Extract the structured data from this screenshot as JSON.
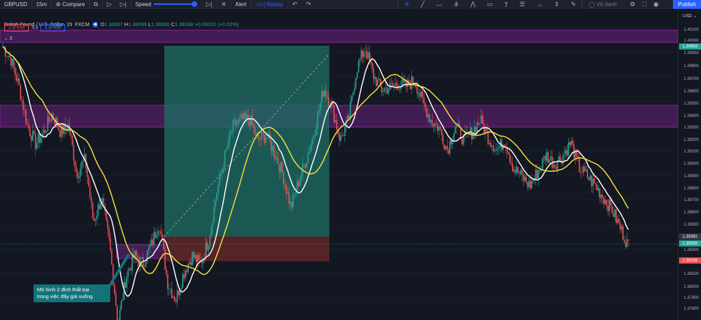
{
  "toolbar": {
    "symbol": "GBPUSD",
    "interval": "15m",
    "compare_label": "Compare",
    "speed_label": "Speed",
    "alert_label": "Alert",
    "replay_label": "Replay",
    "user_label": "Vô danh",
    "publish_label": "Publish"
  },
  "legend": {
    "title": "British Pound / U.S. Dollar",
    "interval": "15",
    "source": "FXCM",
    "o_label": "O",
    "o": "1.38307",
    "h_label": "H",
    "h": "1.38399",
    "l_label": "L",
    "l": "1.38306",
    "c_label": "C",
    "c": "1.38338",
    "change": "+0.00031 (+0.02%)"
  },
  "quote": {
    "sell": "1.37439",
    "spread": "0.3",
    "buy": "1.37439"
  },
  "indicators_toggle": "3",
  "annotation": {
    "text_line1": "Mô hình 2 đỉnh thất bại",
    "text_line2": "trong việc đẩy giá xuống"
  },
  "price_axis": {
    "currency": "USD",
    "ticks": [
      "1.40100",
      "1.40000",
      "1.39900",
      "1.39800",
      "1.39700",
      "1.39600",
      "1.39500",
      "1.39400",
      "1.39300",
      "1.39200",
      "1.39100",
      "1.39000",
      "1.38900",
      "1.38800",
      "1.38700",
      "1.38600",
      "1.38500",
      "1.38300",
      "1.38100",
      "1.38000",
      "1.37900",
      "1.37800"
    ],
    "tag_high": "1.39959",
    "tag_pos": "1.38392",
    "tag_last": "1.38338",
    "tag_low": "1.38195"
  },
  "colors": {
    "bg": "#131722",
    "up": "#26a69a",
    "down": "#ef5350",
    "ma_white": "#ffffff",
    "ma_yellow": "#f7e23c",
    "zone": "#9c27b0",
    "long_profit": "#1f6f66",
    "long_loss": "#6b2a2a",
    "accent": "#2962ff"
  },
  "chart_data": {
    "type": "candlestick",
    "symbol": "GBPUSD",
    "timeframe": "15",
    "ylim": [
      1.377,
      1.4012
    ],
    "price_path": [
      1.3996,
      1.3985,
      1.3962,
      1.393,
      1.3915,
      1.3925,
      1.394,
      1.3925,
      1.393,
      1.389,
      1.3902,
      1.385,
      1.387,
      1.383,
      1.3765,
      1.3805,
      1.3822,
      1.3815,
      1.383,
      1.385,
      1.38,
      1.3785,
      1.3808,
      1.3822,
      1.3815,
      1.3835,
      1.3875,
      1.3905,
      1.393,
      1.3935,
      1.3935,
      1.3918,
      1.3922,
      1.3908,
      1.389,
      1.3862,
      1.3885,
      1.3905,
      1.393,
      1.3962,
      1.3945,
      1.3918,
      1.3935,
      1.3978,
      1.3995,
      1.3972,
      1.396,
      1.3962,
      1.3965,
      1.3963,
      1.3968,
      1.395,
      1.3935,
      1.3928,
      1.391,
      1.393,
      1.3918,
      1.3925,
      1.3935,
      1.392,
      1.391,
      1.3918,
      1.3895,
      1.3888,
      1.388,
      1.3892,
      1.3906,
      1.3898,
      1.3905,
      1.3916,
      1.3895,
      1.3888,
      1.388,
      1.387,
      1.386,
      1.3845,
      1.383
    ],
    "zones": [
      [
        1.4,
        1.401
      ],
      [
        1.393,
        1.3948
      ],
      [
        1.3828,
        1.3838
      ]
    ],
    "long_position": {
      "entry": 1.3838,
      "target": 1.3995,
      "stop": 1.3819
    }
  }
}
